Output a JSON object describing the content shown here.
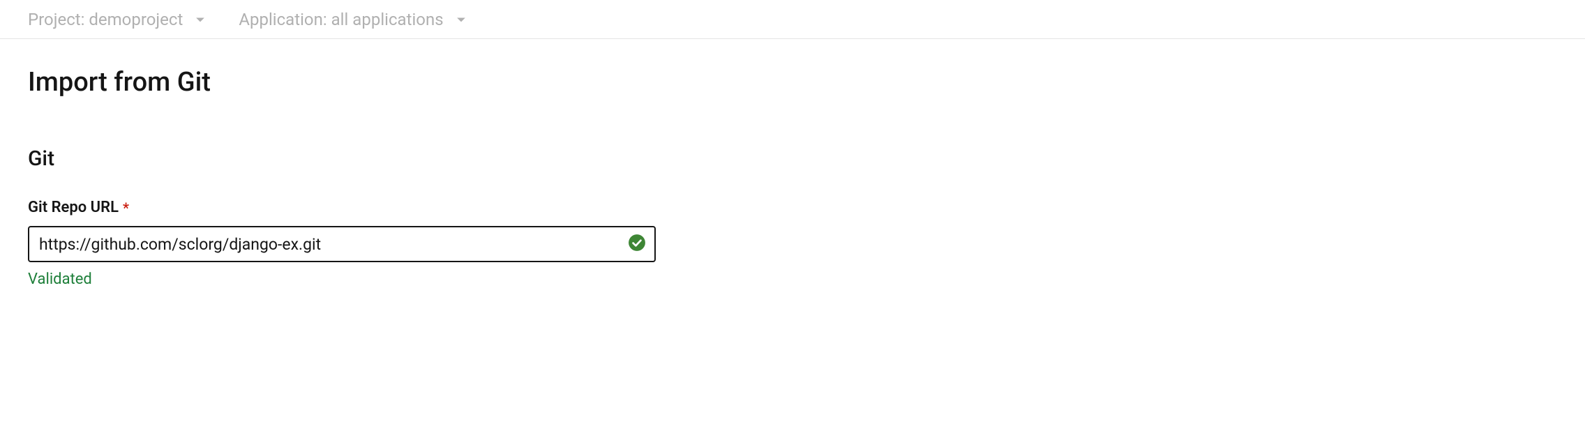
{
  "topbar": {
    "project": {
      "label": "Project:",
      "value": "demoproject"
    },
    "application": {
      "label": "Application:",
      "value": "all applications"
    }
  },
  "page": {
    "title": "Import from Git"
  },
  "git_section": {
    "heading": "Git",
    "repo_url": {
      "label": "Git Repo URL",
      "required_marker": "*",
      "value": "https://github.com/sclorg/django-ex.git",
      "status_text": "Validated",
      "status_color": "#1e7f3a"
    }
  }
}
